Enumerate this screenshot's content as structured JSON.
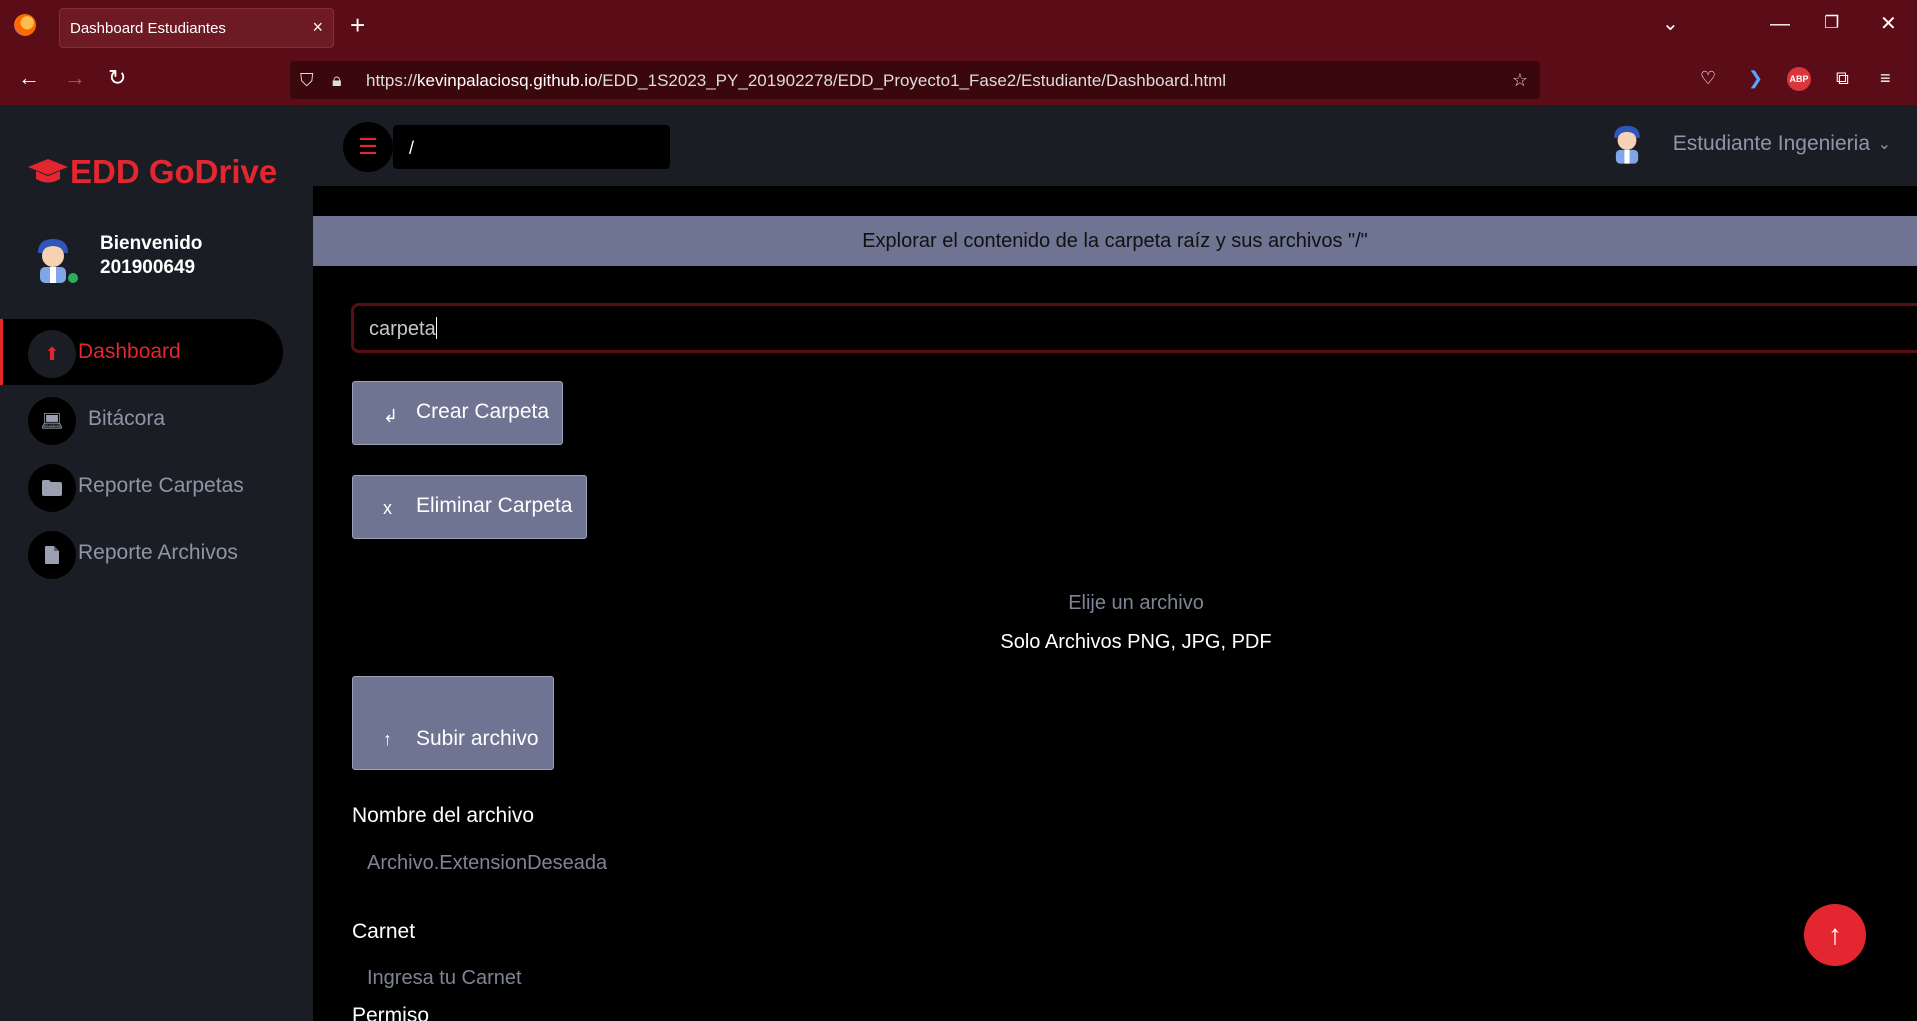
{
  "browser": {
    "tab_title": "Dashboard Estudiantes",
    "url_prefix": "https://",
    "url_domain": "kevinpalaciosq.github.io",
    "url_path": "/EDD_1S2023_PY_201902278/EDD_Proyecto1_Fase2/Estudiante/Dashboard.html"
  },
  "sidebar": {
    "brand": "EDD GoDrive",
    "welcome": "Bienvenido",
    "user_id": "201900649",
    "items": [
      {
        "label": "Dashboard",
        "icon": "upload-icon",
        "active": true
      },
      {
        "label": "Bitácora",
        "icon": "laptop-icon",
        "active": false
      },
      {
        "label": "Reporte Carpetas",
        "icon": "folder-icon",
        "active": false
      },
      {
        "label": "Reporte Archivos",
        "icon": "file-icon",
        "active": false
      }
    ]
  },
  "topbar": {
    "path": "/",
    "user": "Estudiante Ingenieria"
  },
  "main": {
    "banner": "Explorar el contenido de la carpeta raíz y sus archivos \"/\"",
    "folder_input_value": "carpeta",
    "create_folder": "Crear Carpeta",
    "create_icon": "↲",
    "delete_folder": "Eliminar Carpeta",
    "delete_icon": "x",
    "choose_file": "Elije un archivo",
    "file_types": "Solo Archivos PNG, JPG, PDF",
    "upload_file": "Subir archivo",
    "upload_icon": "↑",
    "file_name_label": "Nombre del archivo",
    "file_name_placeholder": "Archivo.ExtensionDeseada",
    "carnet_label": "Carnet",
    "carnet_placeholder": "Ingresa tu Carnet",
    "permission_label": "Permiso"
  },
  "colors": {
    "accent": "#e3262f",
    "chrome": "#5b0d17",
    "sidebar": "#1b1d24",
    "button": "#6e7491"
  }
}
